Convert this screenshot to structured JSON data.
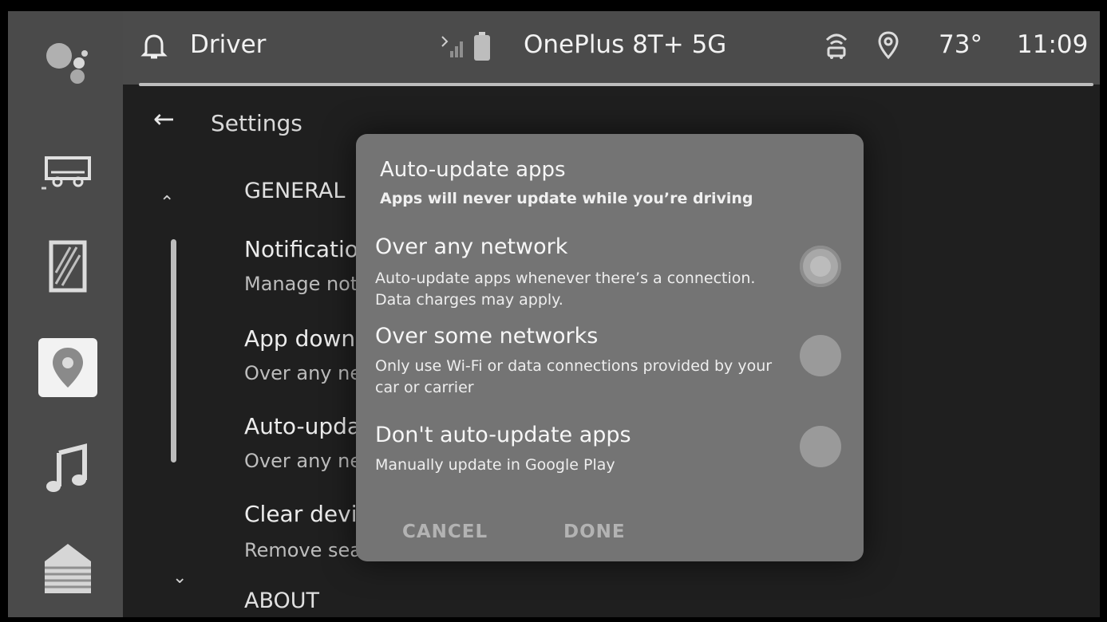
{
  "statusbar": {
    "profile": "Driver",
    "device": "OnePlus 8T+ 5G",
    "temperature": "73°",
    "time": "11:09"
  },
  "settings": {
    "title": "Settings",
    "sections": {
      "general": "GENERAL",
      "about": "ABOUT"
    },
    "items": [
      {
        "title": "Notificatio",
        "subtitle": "Manage not"
      },
      {
        "title": "App downl",
        "subtitle": "Over any ne"
      },
      {
        "title": "Auto-updat",
        "subtitle": "Over any ne"
      },
      {
        "title": "Clear devic",
        "subtitle": "Remove sea"
      }
    ]
  },
  "dialog": {
    "title": "Auto-update apps",
    "subtitle": "Apps will never update while you’re driving",
    "options": [
      {
        "title": "Over any network",
        "desc": "Auto-update apps whenever there’s a connection. Data charges may apply.",
        "selected": true
      },
      {
        "title": "Over some networks",
        "desc": "Only use Wi-Fi or data connections provided by your car or carrier",
        "selected": false
      },
      {
        "title": "Don't auto-update apps",
        "desc": "Manually update in Google Play",
        "selected": false
      }
    ],
    "cancel": "CANCEL",
    "done": "DONE"
  },
  "icons": {
    "assistant": "google-assistant-icon",
    "bell": "bell-icon",
    "phone_signal": "phone-signal-icon",
    "battery": "battery-icon",
    "wifi_car": "car-wifi-icon",
    "location": "location-pin-icon"
  }
}
